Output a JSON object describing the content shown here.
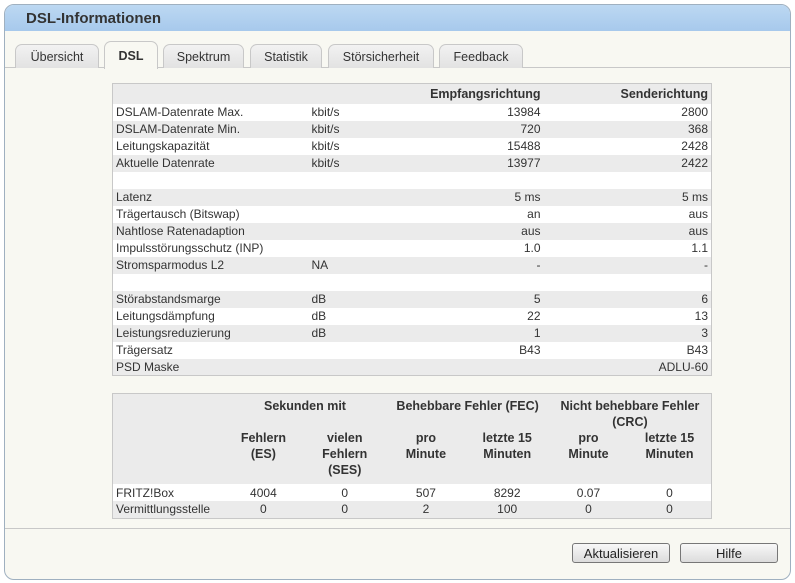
{
  "window": {
    "title": "DSL-Informationen"
  },
  "tabs": [
    {
      "label": "Übersicht"
    },
    {
      "label": "DSL"
    },
    {
      "label": "Spektrum"
    },
    {
      "label": "Statistik"
    },
    {
      "label": "Störsicherheit"
    },
    {
      "label": "Feedback"
    }
  ],
  "active_tab": "DSL",
  "main_table": {
    "headers": [
      "",
      "",
      "Empfangsrichtung",
      "Senderichtung"
    ],
    "rows": [
      [
        "DSLAM-Datenrate Max.",
        "kbit/s",
        "13984",
        "2800"
      ],
      [
        "DSLAM-Datenrate Min.",
        "kbit/s",
        "720",
        "368"
      ],
      [
        "Leitungskapazität",
        "kbit/s",
        "15488",
        "2428"
      ],
      [
        "Aktuelle Datenrate",
        "kbit/s",
        "13977",
        "2422"
      ],
      [
        "",
        "",
        "",
        ""
      ],
      [
        "Latenz",
        "",
        "5 ms",
        "5 ms"
      ],
      [
        "Trägertausch (Bitswap)",
        "",
        "an",
        "aus"
      ],
      [
        "Nahtlose Ratenadaption",
        "",
        "aus",
        "aus"
      ],
      [
        "Impulsstörungsschutz (INP)",
        "",
        "1.0",
        "1.1"
      ],
      [
        "Stromsparmodus L2",
        "NA",
        "-",
        "-"
      ],
      [
        "",
        "",
        "",
        ""
      ],
      [
        "Störabstandsmarge",
        "dB",
        "5",
        "6"
      ],
      [
        "Leitungsdämpfung",
        "dB",
        "22",
        "13"
      ],
      [
        "Leistungsreduzierung",
        "dB",
        "1",
        "3"
      ],
      [
        "Trägersatz",
        "",
        "B43",
        "B43"
      ],
      [
        "PSD Maske",
        "",
        "",
        "ADLU-60"
      ]
    ]
  },
  "error_table": {
    "groups": [
      "Sekunden mit",
      "Behebbare Fehler (FEC)",
      "Nicht behebbare Fehler (CRC)"
    ],
    "subheaders": [
      "Fehlern (ES)",
      "vielen Fehlern (SES)",
      "pro Minute",
      "letzte 15 Minuten",
      "pro Minute",
      "letzte 15 Minuten"
    ],
    "rows": [
      [
        "FRITZ!Box",
        "4004",
        "0",
        "507",
        "8292",
        "0.07",
        "0"
      ],
      [
        "Vermittlungsstelle",
        "0",
        "0",
        "2",
        "100",
        "0",
        "0"
      ]
    ]
  },
  "buttons": {
    "refresh": "Aktualisieren",
    "help": "Hilfe"
  }
}
